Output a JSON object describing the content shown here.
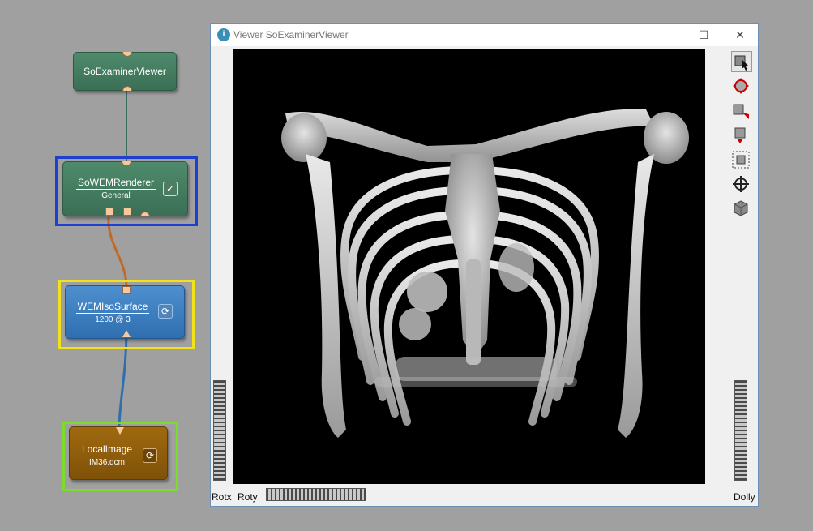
{
  "network": {
    "nodes": [
      {
        "title": "SoExaminerViewer",
        "subtitle": ""
      },
      {
        "title": "SoWEMRenderer",
        "subtitle": "General"
      },
      {
        "title": "WEMIsoSurface",
        "subtitle": "1200 @ 3"
      },
      {
        "title": "LocalImage",
        "subtitle": "IM36.dcm"
      }
    ],
    "highlight_colors": {
      "renderer": "#1f3fcf",
      "isosurface": "#f2e21a",
      "localimage": "#7ddc2a"
    }
  },
  "viewer": {
    "title": "Viewer SoExaminerViewer",
    "controls": {
      "minimize": "—",
      "maximize": "☐",
      "close": "✕"
    },
    "labels": {
      "rotx": "Rotx",
      "roty": "Roty",
      "dolly": "Dolly"
    },
    "tools": [
      "pick-icon",
      "rotate-icon",
      "seek-icon",
      "zoom-icon",
      "view-all-icon",
      "set-home-icon",
      "camera-icon"
    ]
  }
}
